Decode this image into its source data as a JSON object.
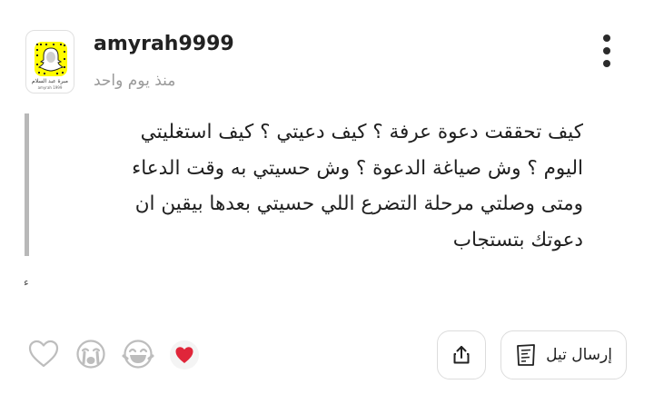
{
  "post": {
    "username": "amyrah9999",
    "timestamp": "منذ يوم واحد",
    "avatar_caption": "مبرة عبد السلام",
    "avatar_subcaption": "amyrah 1999",
    "quote_lines": [
      "كيف تحققت دعوة عرفة ؟ كيف دعيتي ؟ كيف استغليتي",
      "اليوم ؟ وش صياغة الدعوة ؟ وش حسيتي به وقت الدعاء",
      "ومتى وصلتي مرحلة التضرع اللي حسيتي بعدها بيقين ان",
      "دعوتك بتستجاب"
    ],
    "stray_mark": "ء"
  },
  "reactions": [
    {
      "name": "heart-outline-icon",
      "active": false
    },
    {
      "name": "crying-face-icon",
      "active": false
    },
    {
      "name": "laughing-face-icon",
      "active": false
    },
    {
      "name": "red-heart-icon",
      "active": true
    }
  ],
  "actions": {
    "tell_label": "إرسال تيل",
    "share_icon": "share-icon",
    "more_icon": "more-vertical-icon"
  },
  "colors": {
    "accent_red": "#e0263a",
    "snap_yellow": "#fffc00",
    "muted_text": "#9a9a9a",
    "quote_bar": "#b8b8b8"
  }
}
